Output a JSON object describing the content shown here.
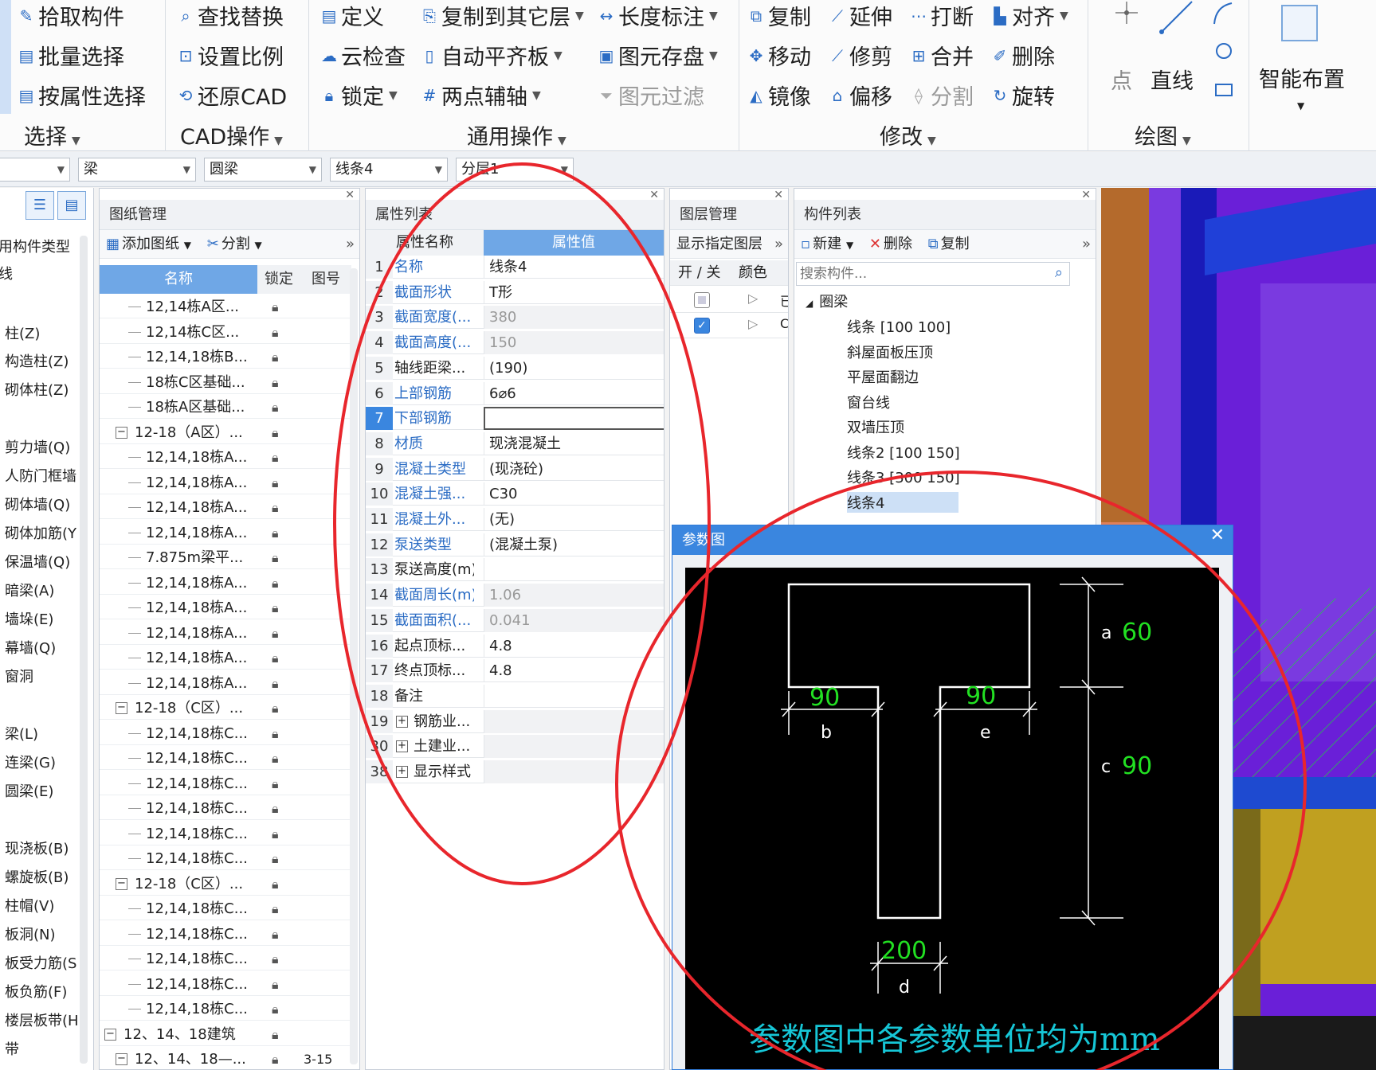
{
  "ribbon": {
    "select": {
      "label": "选择",
      "items": [
        "拾取构件",
        "批量选择",
        "按属性选择"
      ]
    },
    "cad": {
      "label": "CAD操作",
      "items": [
        "查找替换",
        "设置比例",
        "还原CAD"
      ]
    },
    "common": {
      "label": "通用操作",
      "col1": [
        "定义",
        "云检查",
        "锁定"
      ],
      "col2": [
        "复制到其它层",
        "自动平齐板",
        "两点辅轴"
      ],
      "col3": [
        "长度标注",
        "图元存盘",
        "图元过滤"
      ]
    },
    "modify": {
      "label": "修改",
      "col1": [
        "复制",
        "移动",
        "镜像"
      ],
      "col2": [
        "延伸",
        "修剪",
        "偏移"
      ],
      "col3": [
        "打断",
        "合并",
        "分割"
      ],
      "col4": [
        "对齐",
        "删除",
        "旋转"
      ]
    },
    "draw": {
      "label": "绘图",
      "point": "点",
      "line": "直线"
    },
    "smart": {
      "label": "智能布置"
    }
  },
  "combos": [
    "",
    "梁",
    "圆梁",
    "线条4",
    "分层1"
  ],
  "typelist": {
    "items": [
      "用构件类型",
      "线",
      "柱(Z)",
      "构造柱(Z)",
      "砌体柱(Z)",
      "剪力墙(Q)",
      "人防门框墙",
      "砌体墙(Q)",
      "砌体加筋(Y",
      "保温墙(Q)",
      "暗梁(A)",
      "墙垛(E)",
      "幕墙(Q)",
      "窗洞",
      "梁(L)",
      "连梁(G)",
      "圆梁(E)",
      "现浇板(B)",
      "螺旋板(B)",
      "柱帽(V)",
      "板洞(N)",
      "板受力筋(S",
      "板负筋(F)",
      "楼层板带(H",
      "带"
    ]
  },
  "drawing": {
    "title": "图纸管理",
    "add": "添加图纸",
    "split": "分割",
    "cols": [
      "名称",
      "锁定",
      "图号"
    ],
    "rows": [
      {
        "name": "12,14栋A区...",
        "lvl": 2
      },
      {
        "name": "12,14栋C区...",
        "lvl": 2
      },
      {
        "name": "12,14,18栋B...",
        "lvl": 2
      },
      {
        "name": "18栋C区基础...",
        "lvl": 2
      },
      {
        "name": "18栋A区基础...",
        "lvl": 2
      },
      {
        "name": "12-18（A区）...",
        "lvl": 1
      },
      {
        "name": "12,14,18栋A...",
        "lvl": 2
      },
      {
        "name": "12,14,18栋A...",
        "lvl": 2
      },
      {
        "name": "12,14,18栋A...",
        "lvl": 2
      },
      {
        "name": "12,14,18栋A...",
        "lvl": 2
      },
      {
        "name": "7.875m梁平...",
        "lvl": 2
      },
      {
        "name": "12,14,18栋A...",
        "lvl": 2
      },
      {
        "name": "12,14,18栋A...",
        "lvl": 2
      },
      {
        "name": "12,14,18栋A...",
        "lvl": 2
      },
      {
        "name": "12,14,18栋A...",
        "lvl": 2
      },
      {
        "name": "12,14,18栋A...",
        "lvl": 2
      },
      {
        "name": "12-18（C区）...",
        "lvl": 1
      },
      {
        "name": "12,14,18栋C...",
        "lvl": 2
      },
      {
        "name": "12,14,18栋C...",
        "lvl": 2
      },
      {
        "name": "12,14,18栋C...",
        "lvl": 2
      },
      {
        "name": "12,14,18栋C...",
        "lvl": 2
      },
      {
        "name": "12,14,18栋C...",
        "lvl": 2
      },
      {
        "name": "12,14,18栋C...",
        "lvl": 2
      },
      {
        "name": "12-18（C区）...",
        "lvl": 1
      },
      {
        "name": "12,14,18栋C...",
        "lvl": 2
      },
      {
        "name": "12,14,18栋C...",
        "lvl": 2
      },
      {
        "name": "12,14,18栋C...",
        "lvl": 2
      },
      {
        "name": "12,14,18栋C...",
        "lvl": 2
      },
      {
        "name": "12,14,18栋C...",
        "lvl": 2
      },
      {
        "name": "12、14、18建筑",
        "lvl": 0
      },
      {
        "name": "12、14、18—...",
        "lvl": 1,
        "page": "3-15"
      }
    ]
  },
  "props": {
    "title": "属性列表",
    "cols": [
      "属性名称",
      "属性值"
    ],
    "rows": [
      {
        "no": "1",
        "name": "名称",
        "val": "线条4",
        "blue": true
      },
      {
        "no": "2",
        "name": "截面形状",
        "val": "T形",
        "blue": true
      },
      {
        "no": "3",
        "name": "截面宽度(...",
        "val": "380",
        "blue": true,
        "gray": true
      },
      {
        "no": "4",
        "name": "截面高度(...",
        "val": "150",
        "blue": true,
        "gray": true
      },
      {
        "no": "5",
        "name": "轴线距梁...",
        "val": "(190)"
      },
      {
        "no": "6",
        "name": "上部钢筋",
        "val": "6⌀6",
        "blue": true
      },
      {
        "no": "7",
        "name": "下部钢筋",
        "val": "",
        "blue": true,
        "sel": true
      },
      {
        "no": "8",
        "name": "材质",
        "val": "现浇混凝土",
        "blue": true
      },
      {
        "no": "9",
        "name": "混凝土类型",
        "val": "(现浇砼)",
        "blue": true
      },
      {
        "no": "10",
        "name": "混凝土强...",
        "val": "C30",
        "blue": true
      },
      {
        "no": "11",
        "name": "混凝土外...",
        "val": "(无)",
        "blue": true
      },
      {
        "no": "12",
        "name": "泵送类型",
        "val": "(混凝土泵)",
        "blue": true
      },
      {
        "no": "13",
        "name": "泵送高度(m)",
        "val": ""
      },
      {
        "no": "14",
        "name": "截面周长(m)",
        "val": "1.06",
        "blue": true,
        "gray": true
      },
      {
        "no": "15",
        "name": "截面面积(...",
        "val": "0.041",
        "blue": true,
        "gray": true
      },
      {
        "no": "16",
        "name": "起点顶标...",
        "val": "4.8"
      },
      {
        "no": "17",
        "name": "终点顶标...",
        "val": "4.8"
      },
      {
        "no": "18",
        "name": "备注",
        "val": ""
      },
      {
        "no": "19",
        "name": "钢筋业...",
        "val": "",
        "group": true
      },
      {
        "no": "30",
        "name": "土建业...",
        "val": "",
        "group": true
      },
      {
        "no": "38",
        "name": "显示样式",
        "val": "",
        "group": true
      }
    ]
  },
  "layers": {
    "title": "图层管理",
    "show": "显示指定图层",
    "cols": [
      "开 / 关",
      "颜色"
    ],
    "rows": [
      {
        "name": "已",
        "on": false
      },
      {
        "name": "C",
        "on": true
      }
    ]
  },
  "components": {
    "title": "构件列表",
    "new": "新建",
    "delete": "删除",
    "copy": "复制",
    "search_placeholder": "搜索构件...",
    "group": "圈梁",
    "items": [
      "线条 [100 100]",
      "斜屋面板压顶",
      "平屋面翻边",
      "窗台线",
      "双墙压顶",
      "线条2 [100 150]",
      "线条3 [300 150]",
      "线条4"
    ]
  },
  "param": {
    "title": "参数图",
    "a_label": "a",
    "a_val": "60",
    "b_label": "b",
    "b_val": "90",
    "c_label": "c",
    "c_val": "90",
    "d_label": "d",
    "d_val": "200",
    "e_label": "e",
    "e_val": "90",
    "note": "参数图中各参数单位均为mm"
  },
  "colors": {
    "accent": "#2b6cc4",
    "header": "#6fa7e6",
    "dialog": "#3a86df",
    "dim_green": "#22e022",
    "note_cyan": "#16c6d6",
    "circle": "#e8262c"
  }
}
